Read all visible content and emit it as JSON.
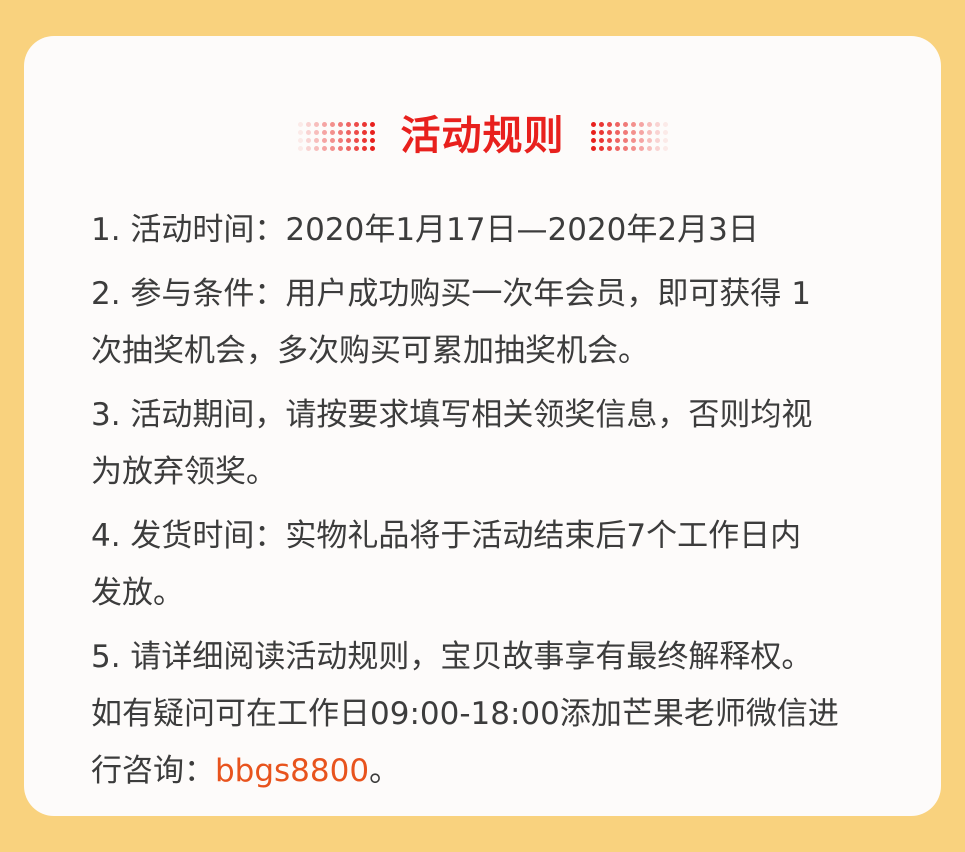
{
  "title": "活动规则",
  "accent_color": "#e8201d",
  "link_color": "#e8531d",
  "rules": [
    {
      "lines": [
        "1. 活动时间：2020年1月17日—2020年2月3日"
      ]
    },
    {
      "lines": [
        "2. 参与条件：用户成功购买一次年会员，即可获得 1",
        "次抽奖机会，多次购买可累加抽奖机会。"
      ]
    },
    {
      "lines": [
        "3. 活动期间，请按要求填写相关领奖信息，否则均视",
        "为放弃领奖。"
      ]
    },
    {
      "lines": [
        "4. 发货时间：实物礼品将于活动结束后7个工作日内",
        "发放。"
      ]
    },
    {
      "lines": [
        "5. 请详细阅读活动规则，宝贝故事享有最终解释权。",
        "如有疑问可在工作日09:00-18:00添加芒果老师微信进"
      ],
      "last_line_prefix": "行咨询：",
      "wechat_id": "bbgs8800",
      "last_line_suffix": "。"
    }
  ]
}
